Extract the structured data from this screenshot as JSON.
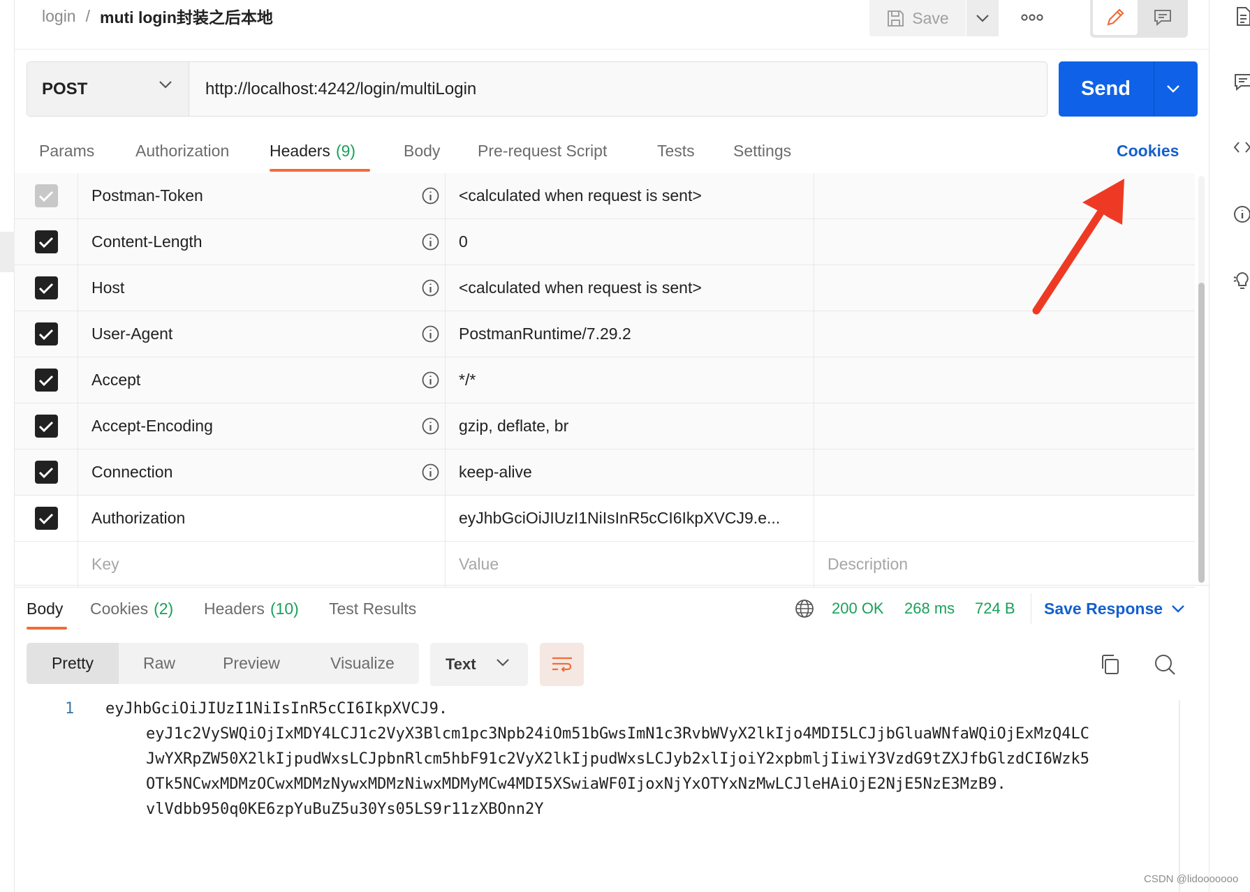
{
  "breadcrumb": {
    "collection": "login",
    "separator": "/",
    "request": "muti login封装之后本地"
  },
  "toolbar": {
    "save_label": "Save"
  },
  "request": {
    "method": "POST",
    "url": "http://localhost:4242/login/multiLogin",
    "send_label": "Send"
  },
  "request_tabs": [
    {
      "label": "Params"
    },
    {
      "label": "Authorization"
    },
    {
      "label": "Headers",
      "count": "(9)"
    },
    {
      "label": "Body"
    },
    {
      "label": "Pre-request Script"
    },
    {
      "label": "Tests"
    },
    {
      "label": "Settings"
    }
  ],
  "cookies_link": "Cookies",
  "headers": [
    {
      "key": "Postman-Token",
      "value": "<calculated when request is sent>",
      "checked": true,
      "disabled": true,
      "info": true
    },
    {
      "key": "Content-Length",
      "value": "0",
      "checked": true,
      "info": true
    },
    {
      "key": "Host",
      "value": "<calculated when request is sent>",
      "checked": true,
      "info": true
    },
    {
      "key": "User-Agent",
      "value": "PostmanRuntime/7.29.2",
      "checked": true,
      "info": true
    },
    {
      "key": "Accept",
      "value": "*/*",
      "checked": true,
      "info": true
    },
    {
      "key": "Accept-Encoding",
      "value": "gzip, deflate, br",
      "checked": true,
      "info": true
    },
    {
      "key": "Connection",
      "value": "keep-alive",
      "checked": true,
      "info": true
    },
    {
      "key": "Authorization",
      "value": "eyJhbGciOiJIUzI1NiIsInR5cCI6IkpXVCJ9.e...",
      "checked": true,
      "info": false
    }
  ],
  "header_placeholders": {
    "key": "Key",
    "value": "Value",
    "description": "Description"
  },
  "response_tabs": [
    {
      "label": "Body"
    },
    {
      "label": "Cookies",
      "count": "(2)"
    },
    {
      "label": "Headers",
      "count": "(10)"
    },
    {
      "label": "Test Results"
    }
  ],
  "response_status": {
    "code": "200 OK",
    "time": "268 ms",
    "size": "724 B"
  },
  "save_response_label": "Save Response",
  "format_tabs": [
    {
      "label": "Pretty"
    },
    {
      "label": "Raw"
    },
    {
      "label": "Preview"
    },
    {
      "label": "Visualize"
    }
  ],
  "format_select": "Text",
  "response_body": {
    "line_number": "1",
    "lines": [
      "eyJhbGciOiJIUzI1NiIsInR5cCI6IkpXVCJ9.",
      "eyJ1c2VySWQiOjIxMDY4LCJ1c2VyX3Blcm1pc3Npb24iOm51bGwsImN1c3RvbWVyX2lkIjo4MDI5LCJjbGluaWNfaWQiOjExMzQ4LC",
      "JwYXRpZW50X2lkIjpudWxsLCJpbnRlcm5hbF91c2VyX2lkIjpudWxsLCJyb2xlIjoiY2xpbmljIiwiY3VzdG9tZXJfbGlzdCI6Wzk5",
      "OTk5NCwxMDMzOCwxMDMzNywxMDMzNiwxMDMyMCw4MDI5XSwiaWF0IjoxNjYxOTYxNzMwLCJleHAiOjE2NjE5NzE3MzB9.",
      "vlVdbb950q0KE6zpYuBuZ5u30Ys05LS9r11zXBOnn2Y"
    ]
  },
  "watermark": "CSDN @lidooooooo",
  "colors": {
    "accent": "#f26b3a",
    "send": "#0f62e8",
    "link": "#1460cc",
    "status": "#19a05a",
    "annotation_arrow": "#ee3a24"
  }
}
